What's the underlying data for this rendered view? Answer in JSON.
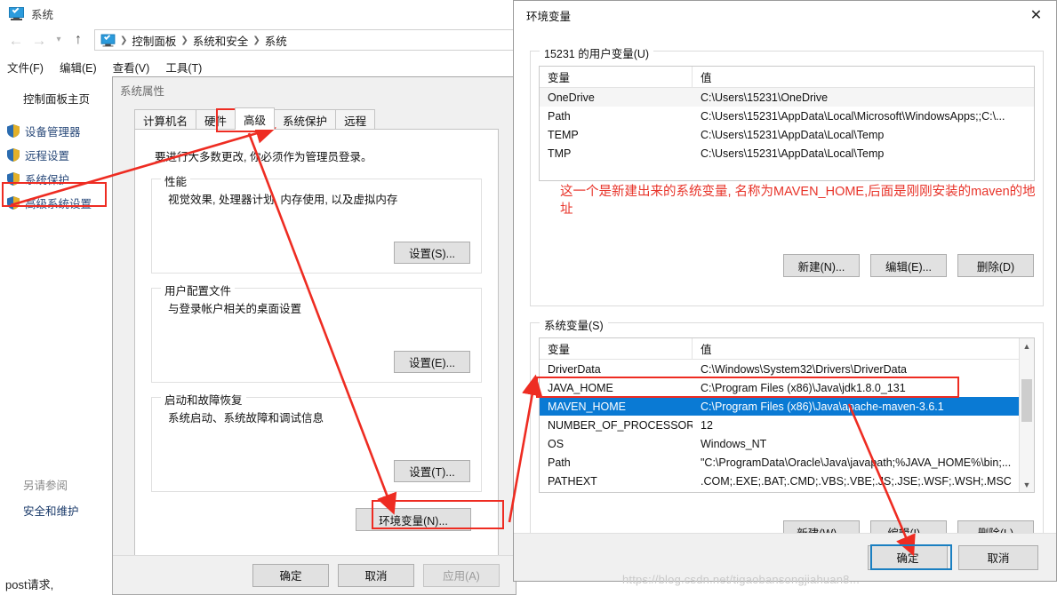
{
  "explorer": {
    "window_title": "系统",
    "breadcrumb": [
      "控制面板",
      "系统和安全",
      "系统"
    ],
    "menu": [
      "文件(F)",
      "编辑(E)",
      "查看(V)",
      "工具(T)"
    ],
    "sidebar": {
      "home": "控制面板主页",
      "items": [
        {
          "label": "设备管理器"
        },
        {
          "label": "远程设置"
        },
        {
          "label": "系统保护"
        },
        {
          "label": "高级系统设置"
        }
      ],
      "see_also_header": "另请参阅",
      "see_also_link": "安全和维护"
    },
    "background_text": "post请求,"
  },
  "system_properties": {
    "title": "系统属性",
    "tabs": [
      {
        "label": "计算机名",
        "active": false
      },
      {
        "label": "硬件",
        "active": false
      },
      {
        "label": "高级",
        "active": true
      },
      {
        "label": "系统保护",
        "active": false
      },
      {
        "label": "远程",
        "active": false
      }
    ],
    "note": "要进行大多数更改, 你必须作为管理员登录。",
    "groups": [
      {
        "title": "性能",
        "desc": "视觉效果, 处理器计划, 内存使用, 以及虚拟内存",
        "button": "设置(S)..."
      },
      {
        "title": "用户配置文件",
        "desc": "与登录帐户相关的桌面设置",
        "button": "设置(E)..."
      },
      {
        "title": "启动和故障恢复",
        "desc": "系统启动、系统故障和调试信息",
        "button": "设置(T)..."
      }
    ],
    "env_button": "环境变量(N)...",
    "footer": {
      "ok": "确定",
      "cancel": "取消",
      "apply": "应用(A)"
    }
  },
  "env_dialog": {
    "title": "环境变量",
    "close_icon": "close-icon",
    "user_section": {
      "legend": "15231 的用户变量(U)",
      "columns": [
        "变量",
        "值"
      ],
      "rows": [
        {
          "name": "OneDrive",
          "value": "C:\\Users\\15231\\OneDrive",
          "selected_bg": true
        },
        {
          "name": "Path",
          "value": "C:\\Users\\15231\\AppData\\Local\\Microsoft\\WindowsApps;;C:\\...",
          "selected_bg": false
        },
        {
          "name": "TEMP",
          "value": "C:\\Users\\15231\\AppData\\Local\\Temp",
          "selected_bg": false
        },
        {
          "name": "TMP",
          "value": "C:\\Users\\15231\\AppData\\Local\\Temp",
          "selected_bg": false
        }
      ],
      "buttons": [
        "新建(N)...",
        "编辑(E)...",
        "删除(D)"
      ]
    },
    "annotation": "这一个是新建出来的系统变量, 名称为MAVEN_HOME,后面是刚刚安装的maven的地址",
    "annotation_color": "#e8342a",
    "system_section": {
      "legend": "系统变量(S)",
      "columns": [
        "变量",
        "值"
      ],
      "rows": [
        {
          "name": "DriverData",
          "value": "C:\\Windows\\System32\\Drivers\\DriverData",
          "selected": false
        },
        {
          "name": "JAVA_HOME",
          "value": "C:\\Program Files (x86)\\Java\\jdk1.8.0_131",
          "selected": false
        },
        {
          "name": "MAVEN_HOME",
          "value": "C:\\Program Files (x86)\\Java\\apache-maven-3.6.1",
          "selected": true
        },
        {
          "name": "NUMBER_OF_PROCESSORS",
          "value": "12",
          "selected": false
        },
        {
          "name": "OS",
          "value": "Windows_NT",
          "selected": false
        },
        {
          "name": "Path",
          "value": "\"C:\\ProgramData\\Oracle\\Java\\javapath;%JAVA_HOME%\\bin;...",
          "selected": false
        },
        {
          "name": "PATHEXT",
          "value": ".COM;.EXE;.BAT;.CMD;.VBS;.VBE;.JS;.JSE;.WSF;.WSH;.MSC",
          "selected": false
        }
      ],
      "buttons": [
        "新建(W)...",
        "编辑(I)...",
        "删除(L)"
      ]
    },
    "footer": {
      "ok": "确定",
      "cancel": "取消"
    },
    "selection_color": "#0a7ad4"
  },
  "watermark": "https://blog.csdn.net/tigaobansongjiahuan8..."
}
